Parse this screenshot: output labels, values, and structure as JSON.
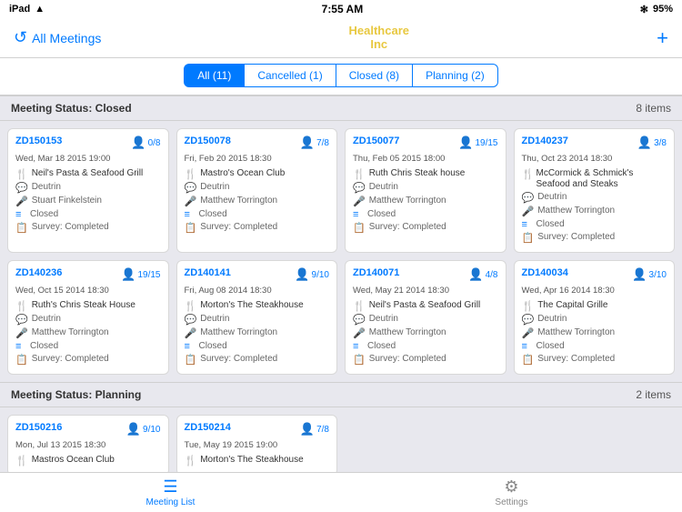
{
  "statusBar": {
    "left": "iPad",
    "wifi": "WiFi",
    "time": "7:55 AM",
    "bluetooth": "BT",
    "battery": "95%"
  },
  "navBar": {
    "refreshLabel": "↺",
    "allMeetingsLabel": "All Meetings",
    "brandLine1": "Healthcare",
    "brandLine2": "Inc",
    "addLabel": "+"
  },
  "filterTabs": [
    {
      "label": "All (11)",
      "active": true
    },
    {
      "label": "Cancelled (1)",
      "active": false
    },
    {
      "label": "Closed (8)",
      "active": false
    },
    {
      "label": "Planning (2)",
      "active": false
    }
  ],
  "sections": [
    {
      "title": "Meeting Status: Closed",
      "count": "8 items",
      "cards": [
        {
          "id": "ZD150153",
          "date": "Wed, Mar 18 2015 19:00",
          "countDisplay": "0/8",
          "restaurant": "Neil's Pasta & Seafood Grill",
          "notes": "Deutrin",
          "speaker": "Stuart Finkelstein",
          "status": "Closed",
          "survey": "Survey: Completed"
        },
        {
          "id": "ZD150078",
          "date": "Fri, Feb 20 2015 18:30",
          "countDisplay": "7/8",
          "restaurant": "Mastro's Ocean Club",
          "notes": "Deutrin",
          "speaker": "Matthew Torrington",
          "status": "Closed",
          "survey": "Survey: Completed"
        },
        {
          "id": "ZD150077",
          "date": "Thu, Feb 05 2015 18:00",
          "countDisplay": "19/15",
          "restaurant": "Ruth Chris  Steak house",
          "notes": "Deutrin",
          "speaker": "Matthew Torrington",
          "status": "Closed",
          "survey": "Survey: Completed"
        },
        {
          "id": "ZD140237",
          "date": "Thu, Oct 23 2014 18:30",
          "countDisplay": "3/8",
          "restaurant": "McCormick & Schmick's Seafood and Steaks",
          "notes": "Deutrin",
          "speaker": "Matthew Torrington",
          "status": "Closed",
          "survey": "Survey: Completed"
        },
        {
          "id": "ZD140236",
          "date": "Wed, Oct 15 2014 18:30",
          "countDisplay": "19/15",
          "restaurant": "Ruth's Chris Steak House",
          "notes": "Deutrin",
          "speaker": "Matthew Torrington",
          "status": "Closed",
          "survey": "Survey: Completed"
        },
        {
          "id": "ZD140141",
          "date": "Fri, Aug 08 2014 18:30",
          "countDisplay": "9/10",
          "restaurant": "Morton's The Steakhouse",
          "notes": "Deutrin",
          "speaker": "Matthew Torrington",
          "status": "Closed",
          "survey": "Survey: Completed"
        },
        {
          "id": "ZD140071",
          "date": "Wed, May 21 2014 18:30",
          "countDisplay": "4/8",
          "restaurant": "Neil's Pasta & Seafood Grill",
          "notes": "Deutrin",
          "speaker": "Matthew Torrington",
          "status": "Closed",
          "survey": "Survey: Completed"
        },
        {
          "id": "ZD140034",
          "date": "Wed, Apr 16 2014 18:30",
          "countDisplay": "3/10",
          "restaurant": "The Capital Grille",
          "notes": "Deutrin",
          "speaker": "Matthew Torrington",
          "status": "Closed",
          "survey": "Survey: Completed"
        }
      ]
    },
    {
      "title": "Meeting Status: Planning",
      "count": "2 items",
      "cards": [
        {
          "id": "ZD150216",
          "date": "Mon, Jul 13 2015 18:30",
          "countDisplay": "9/10",
          "restaurant": "Mastros Ocean Club",
          "notes": "",
          "speaker": "",
          "status": "",
          "survey": ""
        },
        {
          "id": "ZD150214",
          "date": "Tue, May 19 2015 19:00",
          "countDisplay": "7/8",
          "restaurant": "Morton's The Steakhouse",
          "notes": "",
          "speaker": "",
          "status": "",
          "survey": ""
        }
      ]
    }
  ],
  "tabBar": [
    {
      "icon": "☰",
      "label": "Meeting List",
      "active": true
    },
    {
      "icon": "⚙",
      "label": "Settings",
      "active": false
    }
  ]
}
